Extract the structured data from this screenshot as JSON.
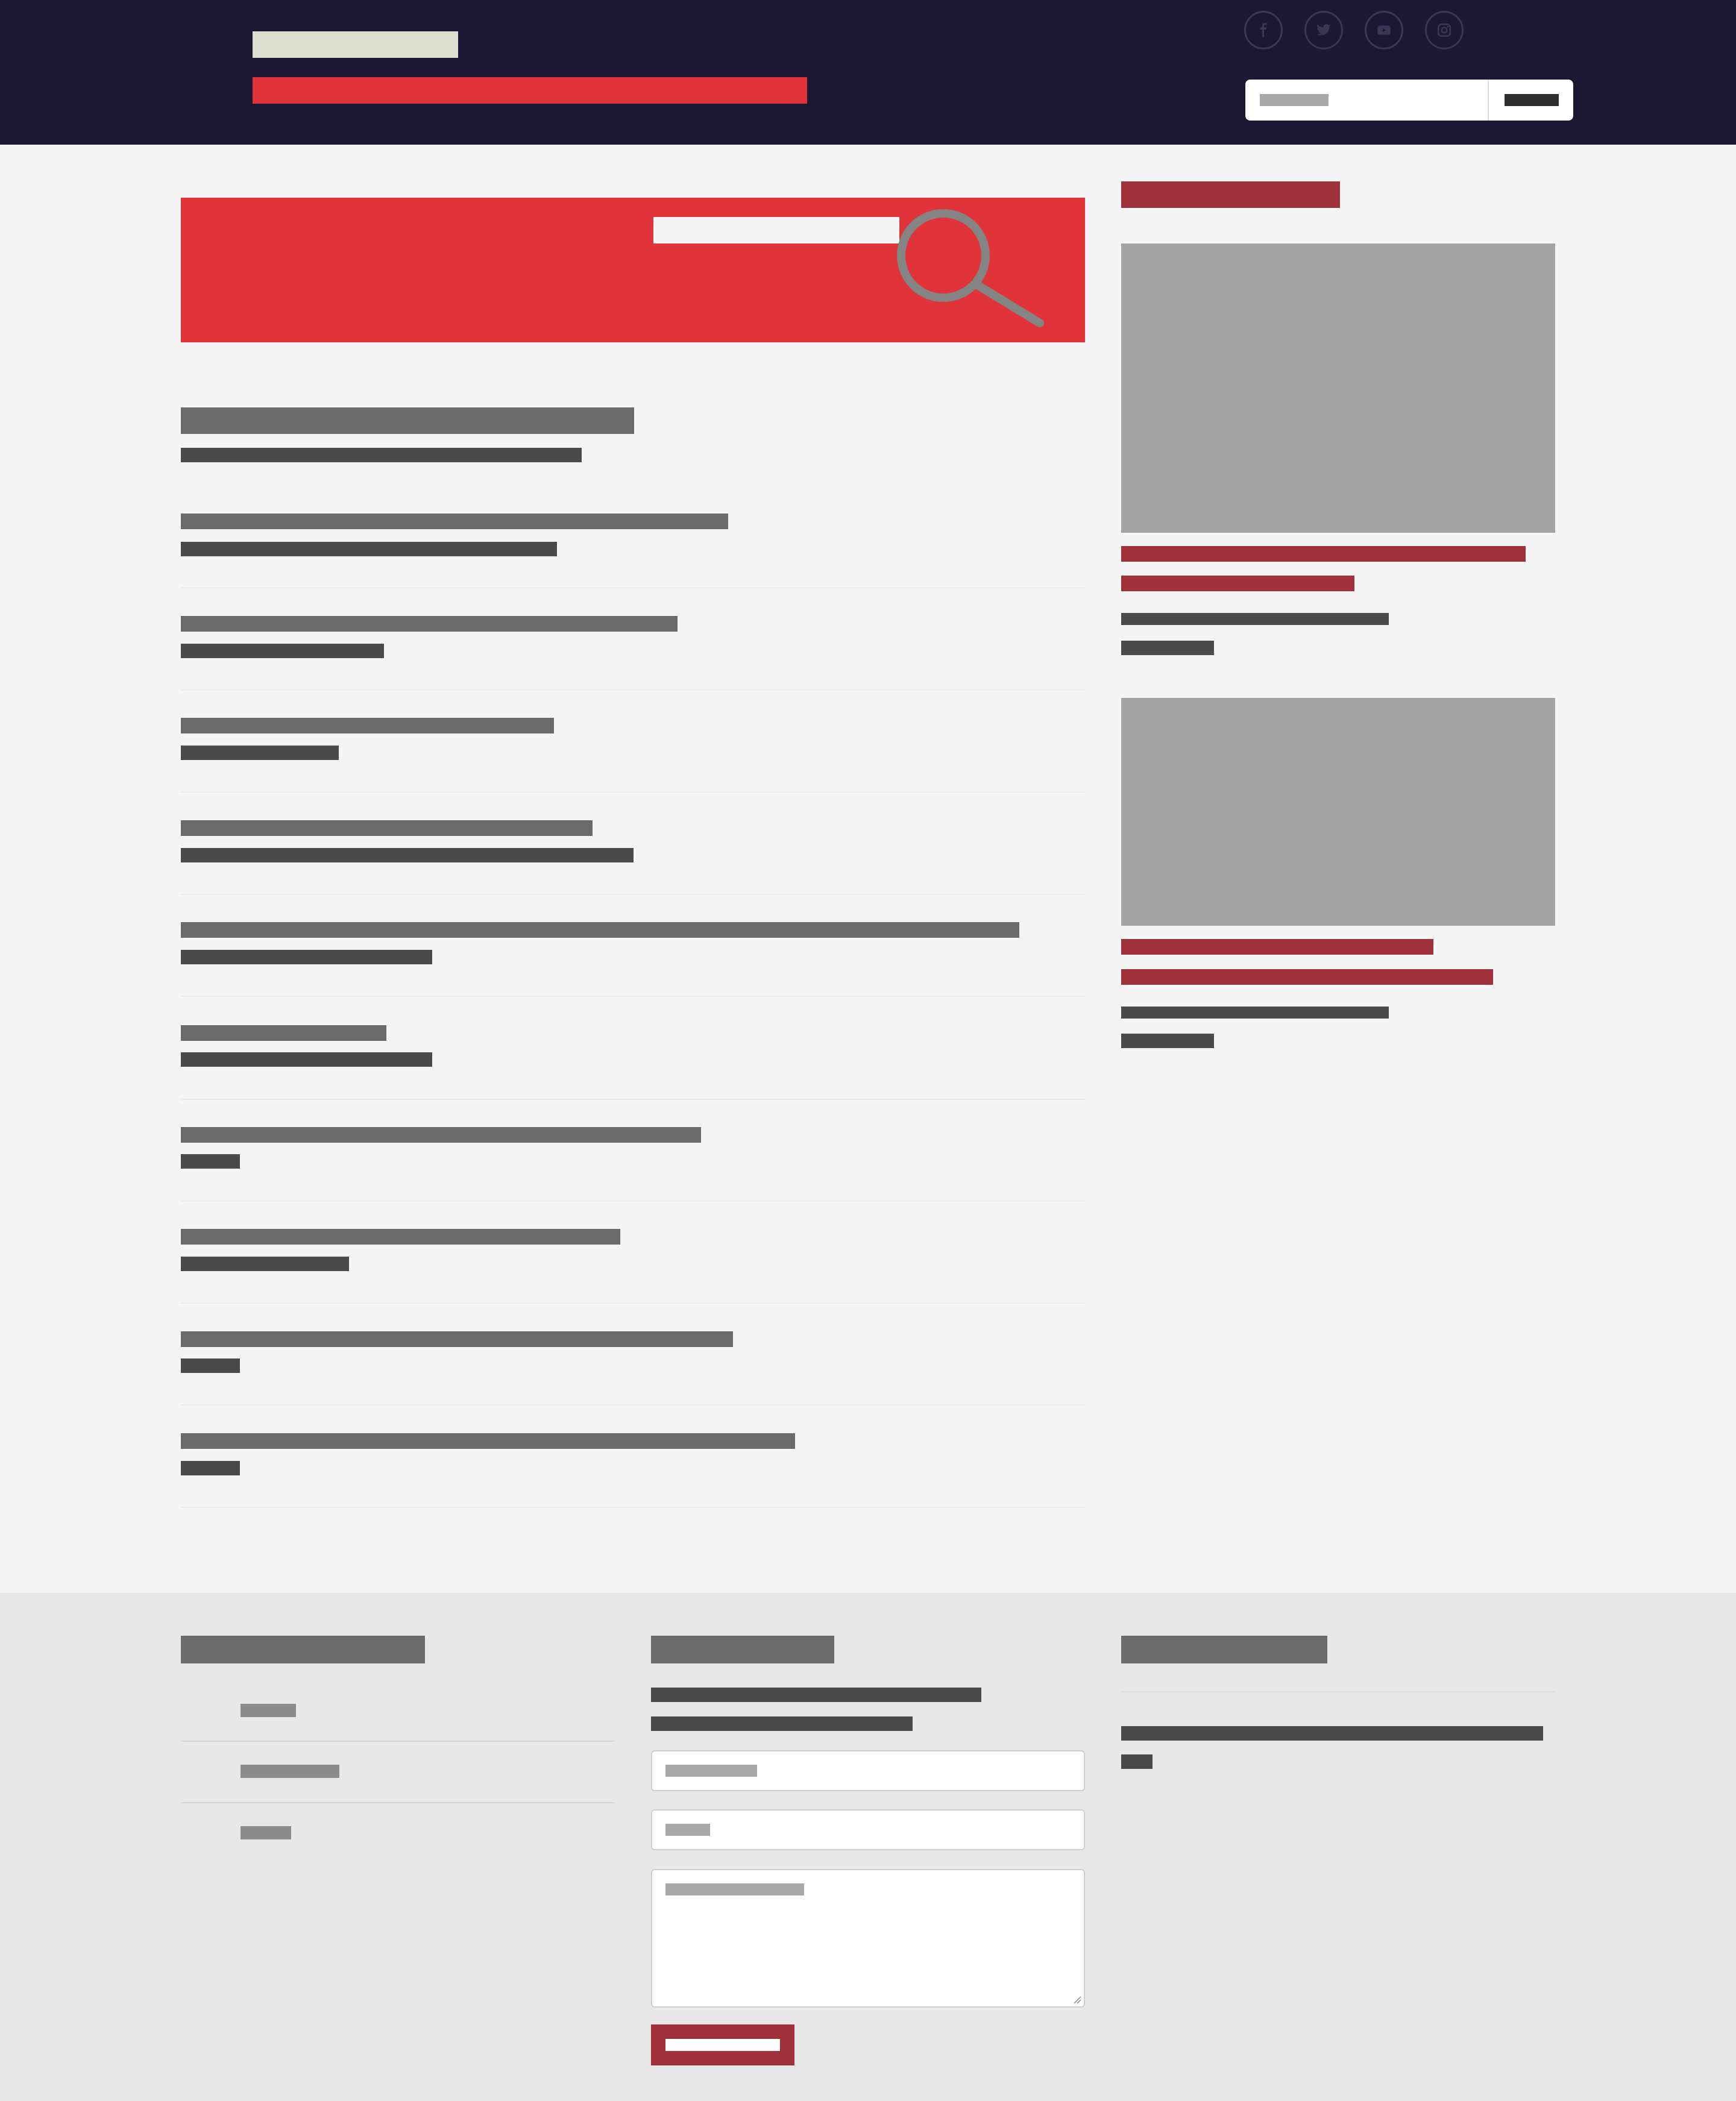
{
  "colors": {
    "header_bg": "#1c1833",
    "accent_red": "#e0343a",
    "dark_red": "#a0313a",
    "page_bg": "#f5f5f5",
    "footer_bg": "#e8e8e8",
    "text_gray": "#6b6b6b",
    "text_dark": "#4a4a4a",
    "placeholder_gray": "#a8a8a8",
    "image_placeholder": "#a3a3a3"
  },
  "header": {
    "logo_icon": "site-logo",
    "social": [
      "facebook-icon",
      "twitter-icon",
      "youtube-icon",
      "instagram-icon"
    ],
    "search_icon": "search-button"
  },
  "hero": {
    "icon": "magnifier-icon"
  },
  "results": {
    "count_visible": 11
  },
  "sidebar": {
    "cards": 2,
    "card_image_icon": "image-placeholder"
  },
  "footer": {
    "menu_items": 3,
    "form_fields": [
      "name-field",
      "email-field",
      "message-textarea"
    ],
    "submit_icon": "submit-button"
  }
}
